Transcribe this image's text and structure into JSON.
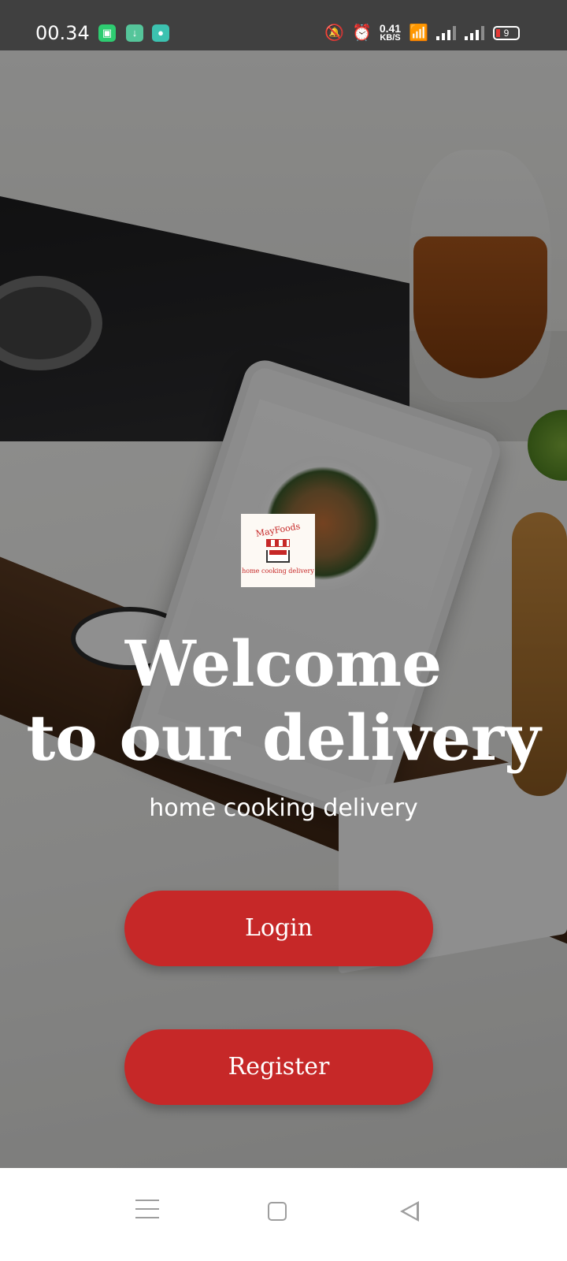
{
  "status_bar": {
    "time": "00.34",
    "net_speed_value": "0.41",
    "net_speed_unit": "KB/S",
    "battery_level": "9",
    "icons": [
      "app-notification-icon",
      "download-icon",
      "chat-icon",
      "mute-bell-icon",
      "alarm-icon",
      "wifi-icon",
      "signal-icon",
      "signal-icon",
      "battery-icon"
    ]
  },
  "logo": {
    "name": "MayFoods",
    "tagline": "home cooking delivery"
  },
  "welcome": {
    "line1": "Welcome",
    "line2": "to our delivery",
    "subtitle": "home cooking delivery"
  },
  "buttons": {
    "login": "Login",
    "register": "Register"
  },
  "colors": {
    "accent": "#c62828",
    "text": "#ffffff"
  }
}
